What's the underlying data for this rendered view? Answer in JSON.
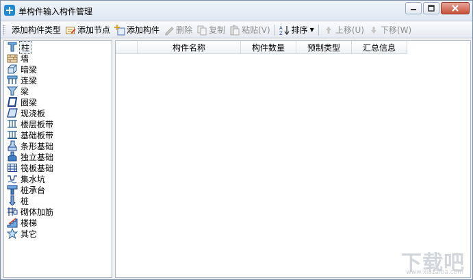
{
  "window": {
    "title": "单构件输入构件管理"
  },
  "toolbar": {
    "items": [
      {
        "label": "添加构件类型",
        "icon": "none",
        "enabled": true
      },
      {
        "label": "添加节点",
        "icon": "add-node-icon",
        "enabled": true
      },
      {
        "label": "添加构件",
        "icon": "add-component-icon",
        "enabled": true
      },
      {
        "label": "删除",
        "icon": "delete-icon",
        "enabled": false
      },
      {
        "label": "复制",
        "icon": "copy-icon",
        "enabled": false
      },
      {
        "label": "粘贴(V)",
        "icon": "paste-icon",
        "enabled": false
      },
      {
        "label": "排序",
        "icon": "sort-icon",
        "enabled": true
      },
      {
        "label": "上移(U)",
        "icon": "move-up-icon",
        "enabled": false
      },
      {
        "label": "下移(W)",
        "icon": "move-down-icon",
        "enabled": false
      }
    ]
  },
  "tree": {
    "items": [
      {
        "label": "柱",
        "icon": "column-icon",
        "selected": true
      },
      {
        "label": "墙",
        "icon": "wall-icon"
      },
      {
        "label": "暗梁",
        "icon": "hidden-beam-icon"
      },
      {
        "label": "连梁",
        "icon": "coupling-beam-icon"
      },
      {
        "label": "梁",
        "icon": "beam-icon"
      },
      {
        "label": "圈梁",
        "icon": "ring-beam-icon"
      },
      {
        "label": "现浇板",
        "icon": "cast-slab-icon"
      },
      {
        "label": "楼层板带",
        "icon": "floor-strip-icon"
      },
      {
        "label": "基础板带",
        "icon": "foundation-strip-icon"
      },
      {
        "label": "条形基础",
        "icon": "strip-foundation-icon"
      },
      {
        "label": "独立基础",
        "icon": "isolated-foundation-icon"
      },
      {
        "label": "筏板基础",
        "icon": "raft-foundation-icon"
      },
      {
        "label": "集水坑",
        "icon": "sump-pit-icon"
      },
      {
        "label": "桩承台",
        "icon": "pile-cap-icon"
      },
      {
        "label": "桩",
        "icon": "pile-icon"
      },
      {
        "label": "砌体加筋",
        "icon": "masonry-rebar-icon"
      },
      {
        "label": "楼梯",
        "icon": "stairs-icon"
      },
      {
        "label": "其它",
        "icon": "star-icon"
      }
    ]
  },
  "list": {
    "columns": [
      "",
      "构件名称",
      "构件数量",
      "预制类型",
      "汇总信息"
    ]
  },
  "watermark": {
    "text": "下载吧",
    "url": "www.xiazaiba.com"
  },
  "colors": {
    "accent": "#1f8ad6",
    "border": "#a6b4c6",
    "close": "#c8503a"
  }
}
